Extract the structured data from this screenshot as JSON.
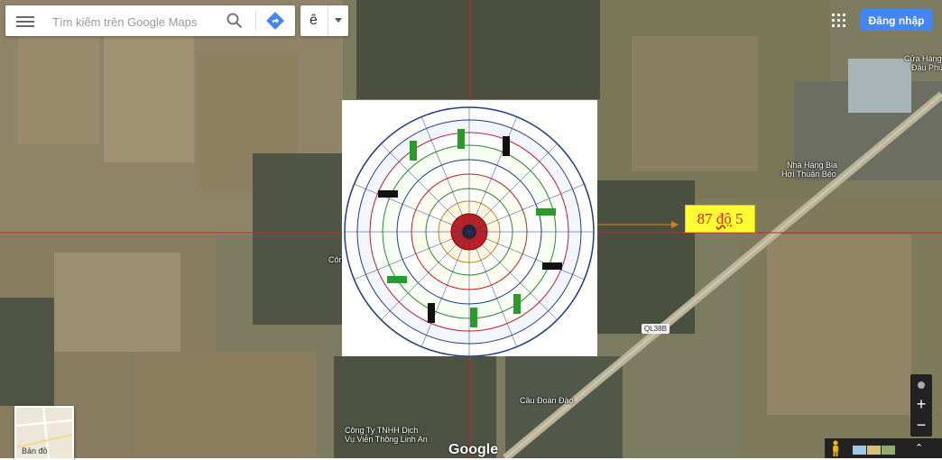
{
  "search": {
    "placeholder": "Tìm kiếm trên Google Maps"
  },
  "language": {
    "selected": "ê"
  },
  "header": {
    "signin_label": "Đăng nhập"
  },
  "overlay_label": {
    "text_pre": "87 ",
    "text_underlined": "độ",
    "text_post": " 5"
  },
  "map_labels": {
    "cua_hang": "Cửa Hàng",
    "dau_phu": "Đậu Phụ",
    "nha_hang_bia": "Nhà Hàng Bia",
    "hoi_thuan_beo": "Hơi Thuận Béo",
    "cong": "Côn",
    "road_ql38b": "QL38B",
    "cau_doan_dao": "Cầu Đoàn Đào",
    "cong_ty_1": "Công Ty TNHH Dịch",
    "cong_ty_2": "Vụ Viễn Thông Linh An"
  },
  "map_type": {
    "label": "Bản đồ"
  },
  "logo": {
    "text": "Google"
  },
  "controls": {
    "zoom_in": "+",
    "zoom_out": "−",
    "expand": "⌃"
  },
  "icons": [
    "menu-icon",
    "search-icon",
    "directions-icon",
    "caret-down-icon",
    "apps-grid-icon",
    "pegman-icon",
    "compass-icon"
  ],
  "colors": {
    "signin_bg": "#4285f4",
    "label_bg": "#ffff33",
    "label_text": "#e02020",
    "crosshair": "#d02020"
  }
}
